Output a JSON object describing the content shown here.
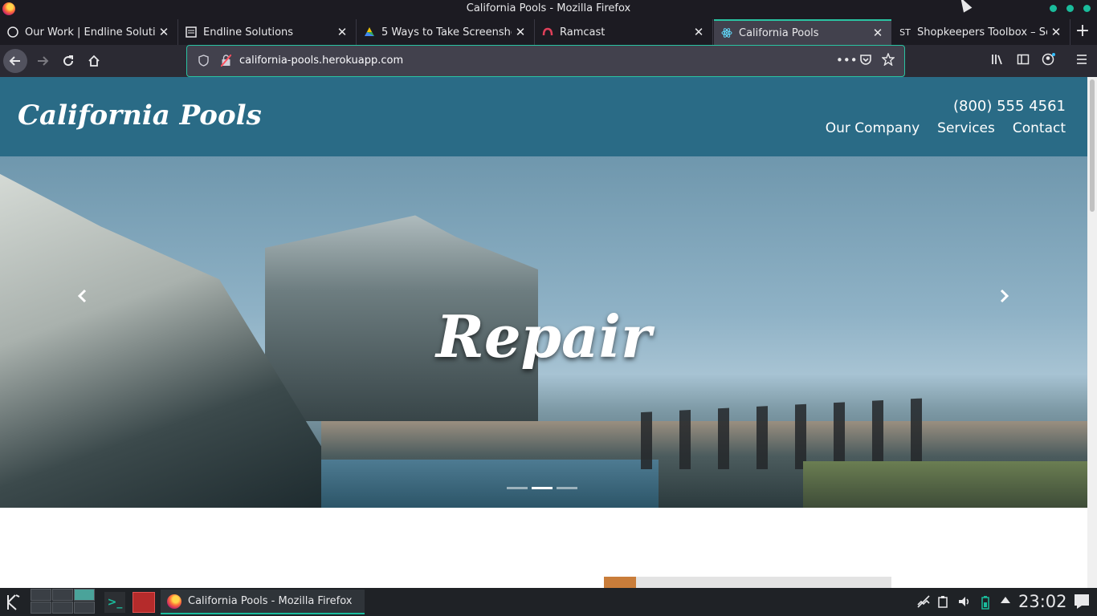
{
  "window": {
    "title": "California Pools - Mozilla Firefox"
  },
  "tabs": [
    {
      "label": "Our Work | Endline Soluti",
      "favicon": "github-icon"
    },
    {
      "label": "Endline Solutions",
      "favicon": "page-icon"
    },
    {
      "label": "5 Ways to Take Screensho",
      "favicon": "drive-icon"
    },
    {
      "label": "Ramcast",
      "favicon": "ramcast-icon"
    },
    {
      "label": "California Pools",
      "favicon": "react-icon",
      "active": true
    },
    {
      "label": "Shopkeepers Toolbox – Sc",
      "favicon": "st-icon",
      "favicon_text": "ST"
    }
  ],
  "nav": {
    "url": "california-pools.herokuapp.com"
  },
  "site": {
    "brand": "California Pools",
    "phone": "(800) 555 4561",
    "menu": [
      "Our Company",
      "Services",
      "Contact"
    ],
    "hero_title": "Repair",
    "carousel_slides": 3,
    "carousel_active": 2
  },
  "taskbar": {
    "task_label": "California Pools - Mozilla Firefox",
    "clock": "23:02",
    "accent": "#1abc9c"
  }
}
